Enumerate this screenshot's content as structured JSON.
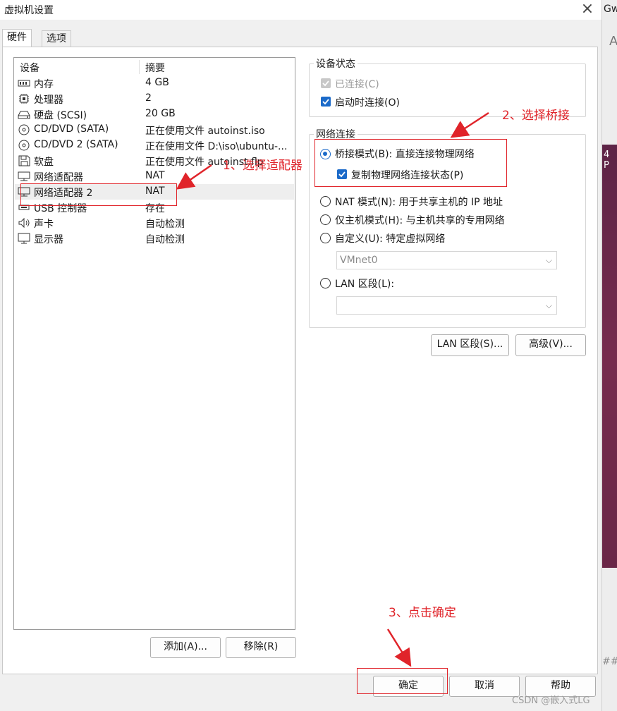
{
  "window": {
    "title": "虚拟机设置",
    "close_icon": "close-icon"
  },
  "tabs": [
    {
      "label": "硬件"
    },
    {
      "label": "选项"
    }
  ],
  "device_list": {
    "headers": {
      "device": "设备",
      "summary": "摘要"
    },
    "rows": [
      {
        "icon": "memory-icon",
        "name": "内存",
        "value": "4 GB"
      },
      {
        "icon": "cpu-icon",
        "name": "处理器",
        "value": "2"
      },
      {
        "icon": "harddisk-icon",
        "name": "硬盘 (SCSI)",
        "value": "20 GB"
      },
      {
        "icon": "cd-dvd-icon",
        "name": "CD/DVD (SATA)",
        "value": "正在使用文件 autoinst.iso"
      },
      {
        "icon": "cd-dvd-icon",
        "name": "CD/DVD 2 (SATA)",
        "value": "正在使用文件 D:\\iso\\ubuntu-..."
      },
      {
        "icon": "floppy-icon",
        "name": "软盘",
        "value": "正在使用文件 autoinst.flp"
      },
      {
        "icon": "network-adapter-icon",
        "name": "网络适配器",
        "value": "NAT"
      },
      {
        "icon": "network-adapter-icon",
        "name": "网络适配器 2",
        "value": "NAT",
        "selected": true
      },
      {
        "icon": "usb-icon",
        "name": "USB 控制器",
        "value": "存在"
      },
      {
        "icon": "sound-icon",
        "name": "声卡",
        "value": "自动检测"
      },
      {
        "icon": "display-icon",
        "name": "显示器",
        "value": "自动检测"
      }
    ]
  },
  "buttons": {
    "add": "添加(A)...",
    "remove": "移除(R)",
    "lan_segments": "LAN 区段(S)...",
    "advanced": "高级(V)...",
    "ok": "确定",
    "cancel": "取消",
    "help": "帮助"
  },
  "device_status": {
    "title": "设备状态",
    "connected": {
      "label": "已连接(C)",
      "checked": true,
      "disabled": true
    },
    "connect_at_power_on": {
      "label": "启动时连接(O)",
      "checked": true
    }
  },
  "network_connection": {
    "title": "网络连接",
    "bridged": {
      "label": "桥接模式(B): 直接连接物理网络",
      "selected": true
    },
    "replicate": {
      "label": "复制物理网络连接状态(P)",
      "checked": true
    },
    "nat": {
      "label": "NAT 模式(N): 用于共享主机的 IP 地址"
    },
    "host_only": {
      "label": "仅主机模式(H): 与主机共享的专用网络"
    },
    "custom": {
      "label": "自定义(U): 特定虚拟网络",
      "combo_value": "VMnet0"
    },
    "lan_segment": {
      "label": "LAN 区段(L):",
      "combo_value": ""
    }
  },
  "annotations": {
    "step1": "1、选择适配器",
    "step2": "2、选择桥接",
    "step3": "3、点击确定",
    "accent_color": "#e0242a"
  },
  "background_window": {
    "text1": "Gw",
    "text2": "A",
    "text3": "4 P",
    "text4": "##"
  },
  "watermark": "CSDN @嵌入式LG"
}
